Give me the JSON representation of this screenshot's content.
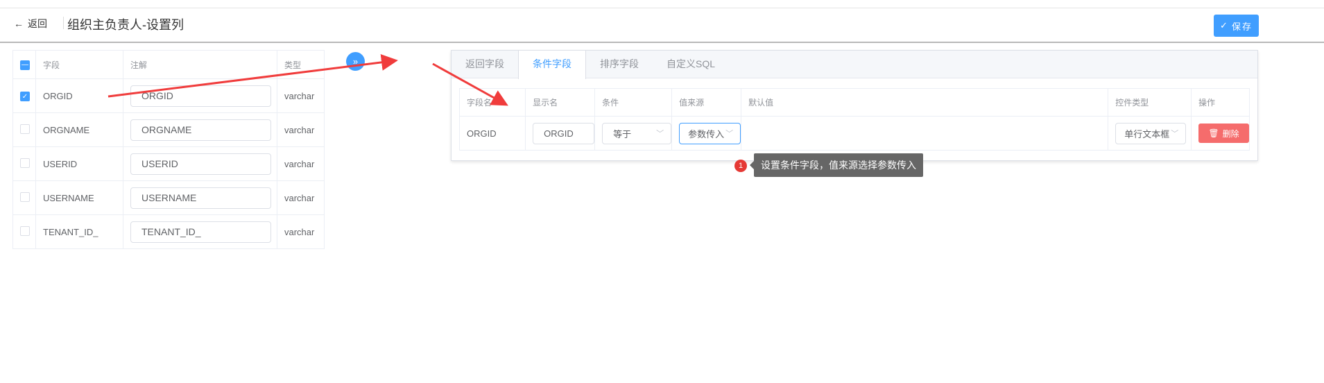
{
  "header": {
    "back_label": "返回",
    "title": "组织主负责人-设置列",
    "save_label": "保存"
  },
  "left_table": {
    "headers": [
      "字段",
      "注解",
      "类型"
    ],
    "rows": [
      {
        "field": "ORGID",
        "comment": "ORGID",
        "type": "varchar",
        "checked": true
      },
      {
        "field": "ORGNAME",
        "comment": "ORGNAME",
        "type": "varchar",
        "checked": false
      },
      {
        "field": "USERID",
        "comment": "USERID",
        "type": "varchar",
        "checked": false
      },
      {
        "field": "USERNAME",
        "comment": "USERNAME",
        "type": "varchar",
        "checked": false
      },
      {
        "field": "TENANT_ID_",
        "comment": "TENANT_ID_",
        "type": "varchar",
        "checked": false
      }
    ]
  },
  "tabs": [
    "返回字段",
    "条件字段",
    "排序字段",
    "自定义SQL"
  ],
  "active_tab": "条件字段",
  "condition_table": {
    "headers": [
      "字段名",
      "显示名",
      "条件",
      "值来源",
      "默认值",
      "控件类型",
      "操作"
    ],
    "rows": [
      {
        "field": "ORGID",
        "display": "ORGID",
        "condition": "等于",
        "source": "参数传入",
        "default": "",
        "control": "单行文本框",
        "action": "删除"
      }
    ]
  },
  "annotation": {
    "badge": "1",
    "text": "设置条件字段，值来源选择参数传入"
  },
  "colors": {
    "primary": "#409eff",
    "danger": "#f56c6c",
    "arrow": "#f03c3c"
  }
}
